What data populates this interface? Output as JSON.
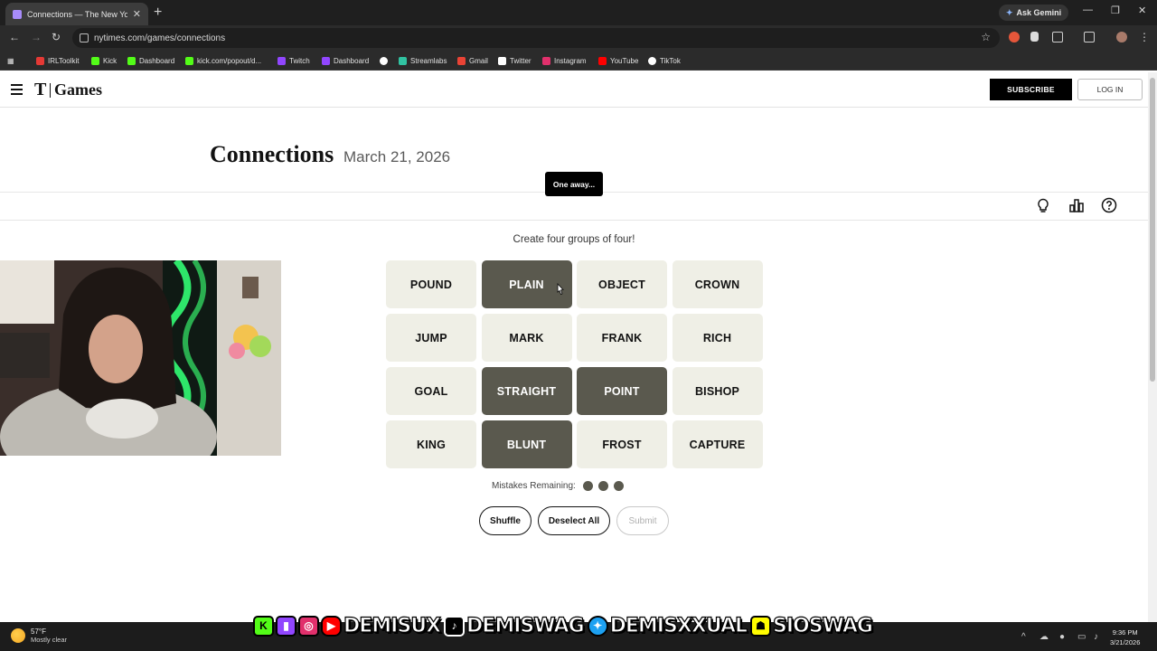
{
  "browser": {
    "tab_title": "Connections — The New York T",
    "new_tab": "+",
    "gemini_label": "Ask Gemini",
    "url": "nytimes.com/games/connections",
    "bookmarks": [
      "IRLToolkit",
      "Kick",
      "Dashboard",
      "kick.com/popout/d...",
      "Twitch",
      "Dashboard",
      "",
      "Streamlabs",
      "Gmail",
      "Twitter",
      "Instagram",
      "YouTube",
      "TikTok"
    ],
    "bookmark_colors": [
      "#e53935",
      "#53fc18",
      "#53fc18",
      "#53fc18",
      "#9146ff",
      "#9146ff",
      "#ffffff",
      "#31c3a2",
      "#ea4335",
      "#ffffff",
      "#e1306c",
      "#ff0000",
      "#ffffff"
    ]
  },
  "header": {
    "logo_mark": "T",
    "brand": "Games",
    "subscribe": "SUBSCRIBE",
    "login": "LOG IN"
  },
  "game": {
    "title": "Connections",
    "date": "March 21, 2026",
    "toast": "One away...",
    "instructions": "Create four groups of four!",
    "cards": [
      {
        "word": "POUND",
        "selected": false
      },
      {
        "word": "PLAIN",
        "selected": true
      },
      {
        "word": "OBJECT",
        "selected": false
      },
      {
        "word": "CROWN",
        "selected": false
      },
      {
        "word": "JUMP",
        "selected": false
      },
      {
        "word": "MARK",
        "selected": false
      },
      {
        "word": "FRANK",
        "selected": false
      },
      {
        "word": "RICH",
        "selected": false
      },
      {
        "word": "GOAL",
        "selected": false
      },
      {
        "word": "STRAIGHT",
        "selected": true
      },
      {
        "word": "POINT",
        "selected": true
      },
      {
        "word": "BISHOP",
        "selected": false
      },
      {
        "word": "KING",
        "selected": false
      },
      {
        "word": "BLUNT",
        "selected": true
      },
      {
        "word": "FROST",
        "selected": false
      },
      {
        "word": "CAPTURE",
        "selected": false
      }
    ],
    "mistakes_label": "Mistakes Remaining:",
    "mistakes_remaining": 3,
    "buttons": {
      "shuffle": "Shuffle",
      "deselect": "Deselect All",
      "submit": "Submit"
    },
    "selected_color": "#5a594e",
    "card_color": "#efefe6"
  },
  "overlay": {
    "handles": [
      "DEMISUX",
      "DEMISWAG",
      "DEMISXXUAL",
      "SIOSWAG"
    ]
  },
  "taskbar": {
    "temp": "57°F",
    "condition": "Mostly clear",
    "time": "9:36 PM",
    "date": "3/21/2026"
  }
}
